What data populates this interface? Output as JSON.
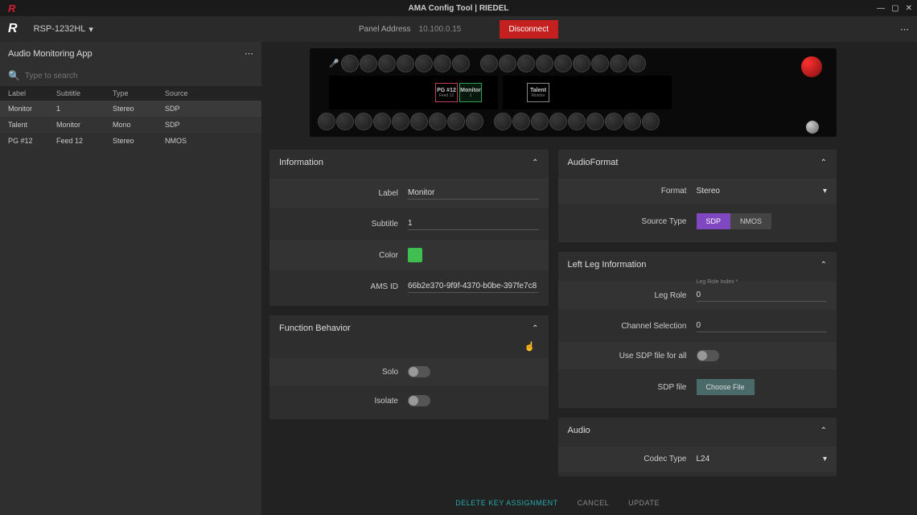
{
  "window": {
    "title": "AMA Config Tool | RIEDEL"
  },
  "topbar": {
    "device": "RSP-1232HL",
    "panel_address_label": "Panel Address",
    "panel_address_value": "10.100.0.15",
    "disconnect": "Disconnect"
  },
  "sidebar": {
    "title": "Audio Monitoring App",
    "search_placeholder": "Type to search",
    "columns": {
      "label": "Label",
      "subtitle": "Subtitle",
      "type": "Type",
      "source": "Source"
    },
    "rows": [
      {
        "label": "Monitor",
        "subtitle": "1",
        "type": "Stereo",
        "source": "SDP"
      },
      {
        "label": "Talent",
        "subtitle": "Monitor",
        "type": "Mono",
        "source": "SDP"
      },
      {
        "label": "PG #12",
        "subtitle": "Feed 12",
        "type": "Stereo",
        "source": "NMOS"
      }
    ]
  },
  "preview": {
    "keys": {
      "pg": {
        "title": "PG #12",
        "sub": "Feed 12"
      },
      "mon": {
        "title": "Monitor",
        "sub": "1"
      },
      "tal": {
        "title": "Talent",
        "sub": "Monitor"
      }
    }
  },
  "sections": {
    "information": {
      "title": "Information",
      "label_lbl": "Label",
      "label_val": "Monitor",
      "subtitle_lbl": "Subtitle",
      "subtitle_val": "1",
      "color_lbl": "Color",
      "color_val": "#3fbf4f",
      "amsid_lbl": "AMS ID",
      "amsid_val": "66b2e370-9f9f-4370-b0be-397fe7c8"
    },
    "function": {
      "title": "Function Behavior",
      "solo_lbl": "Solo",
      "isolate_lbl": "Isolate"
    },
    "audioformat": {
      "title": "AudioFormat",
      "format_lbl": "Format",
      "format_val": "Stereo",
      "source_type_lbl": "Source Type",
      "sdp": "SDP",
      "nmos": "NMOS"
    },
    "leftleg": {
      "title": "Left Leg Information",
      "leg_role_lbl": "Leg Role",
      "leg_role_hint": "Leg Role Index *",
      "leg_role_val": "0",
      "channel_lbl": "Channel Selection",
      "channel_val": "0",
      "usesdp_lbl": "Use SDP file for all",
      "sdpfile_lbl": "SDP file",
      "choose_file": "Choose File"
    },
    "audio": {
      "title": "Audio",
      "codec_lbl": "Codec Type",
      "codec_val": "L24"
    }
  },
  "footer": {
    "delete": "DELETE KEY ASSIGNMENT",
    "cancel": "CANCEL",
    "update": "UPDATE"
  }
}
